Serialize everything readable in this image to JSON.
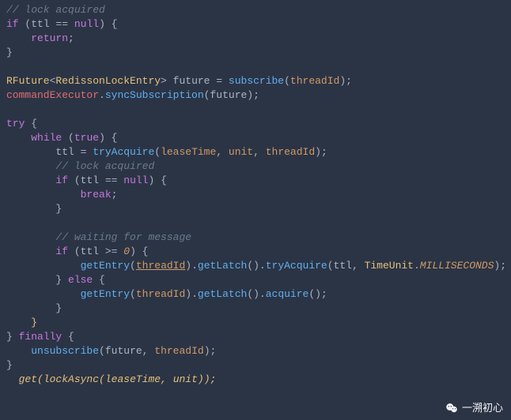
{
  "code": {
    "l0_comment": "// lock acquired",
    "l1_if": "if",
    "l1_open": " (",
    "l1_ttl": "ttl",
    "l1_eq": " == ",
    "l1_null": "null",
    "l1_close": ") {",
    "l2_return": "return",
    "l2_semi": ";",
    "l3_brace": "}",
    "l5_type": "RFuture",
    "l5_lt": "<",
    "l5_gen": "RedissonLockEntry",
    "l5_gt": ">",
    "l5_sp": " ",
    "l5_future": "future",
    "l5_eq": " = ",
    "l5_sub": "subscribe",
    "l5_open": "(",
    "l5_arg": "threadId",
    "l5_close": ");",
    "l6_exec": "commandExecutor",
    "l6_dot": ".",
    "l6_sync": "syncSubscription",
    "l6_open": "(",
    "l6_arg": "future",
    "l6_close": ");",
    "l8_try": "try",
    "l8_brace": " {",
    "l9_while": "while",
    "l9_open": " (",
    "l9_true": "true",
    "l9_close": ") {",
    "l10_ttl": "ttl",
    "l10_eq": " = ",
    "l10_try": "tryAcquire",
    "l10_open": "(",
    "l10_a1": "leaseTime",
    "l10_c1": ", ",
    "l10_a2": "unit",
    "l10_c2": ", ",
    "l10_a3": "threadId",
    "l10_close": ");",
    "l11_comment": "// lock acquired",
    "l12_if": "if",
    "l12_open": " (",
    "l12_ttl": "ttl",
    "l12_eq": " == ",
    "l12_null": "null",
    "l12_close": ") {",
    "l13_break": "break",
    "l13_semi": ";",
    "l14_brace": "}",
    "l16_comment": "// waiting for message",
    "l17_if": "if",
    "l17_open": " (",
    "l17_ttl": "ttl",
    "l17_ge": " >= ",
    "l17_zero": "0",
    "l17_close": ") {",
    "l18_get": "getEntry",
    "l18_o1": "(",
    "l18_tid": "threadId",
    "l18_c1": ").",
    "l18_latch": "getLatch",
    "l18_o2": "().",
    "l18_try": "tryAcquire",
    "l18_o3": "(",
    "l18_ttl": "ttl",
    "l18_comma": ", ",
    "l18_tu": "TimeUnit",
    "l18_dot": ".",
    "l18_ms": "MILLISECONDS",
    "l18_close": ");",
    "l19_brace": "} ",
    "l19_else": "else",
    "l19_open": " {",
    "l20_get": "getEntry",
    "l20_o1": "(",
    "l20_tid": "threadId",
    "l20_c1": ").",
    "l20_latch": "getLatch",
    "l20_o2": "().",
    "l20_acq": "acquire",
    "l20_close": "();",
    "l21_brace": "}",
    "l22_brace": "}",
    "l23_brace": "} ",
    "l23_finally": "finally",
    "l23_open": " {",
    "l24_unsub": "unsubscribe",
    "l24_open": "(",
    "l24_a1": "future",
    "l24_c": ", ",
    "l24_a2": "threadId",
    "l24_close": ");",
    "l25_brace": "}",
    "l26_get": "get",
    "l26_open": "(",
    "l26_lock": "lockAsync",
    "l26_o2": "(",
    "l26_a1": "leaseTime",
    "l26_c": ", ",
    "l26_a2": "unit",
    "l26_close": "));"
  },
  "watermark": {
    "text": "一溯初心"
  }
}
